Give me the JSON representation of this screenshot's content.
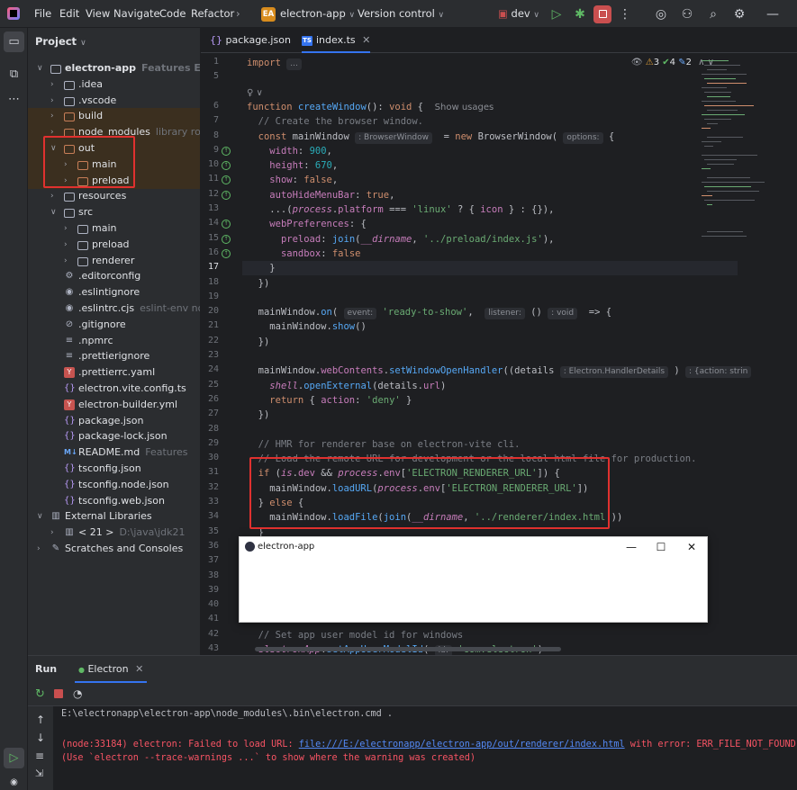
{
  "titlebar": {
    "menus": [
      "File",
      "Edit",
      "View",
      "Navigate",
      "Code",
      "Refactor"
    ],
    "project_badge": "EA",
    "project_name": "electron-app",
    "vcs": "Version control",
    "run_config": "dev"
  },
  "project": {
    "title": "Project",
    "tree": [
      {
        "label": "electron-app",
        "hint": "Features  E:\\electronapp",
        "indent": 0,
        "arrow": "open",
        "icon": "module",
        "excluded": false,
        "bold": true
      },
      {
        "label": ".idea",
        "hint": "",
        "indent": 1,
        "arrow": "closed",
        "icon": "folder",
        "excluded": false
      },
      {
        "label": ".vscode",
        "hint": "",
        "indent": 1,
        "arrow": "closed",
        "icon": "folder",
        "excluded": false
      },
      {
        "label": "build",
        "hint": "",
        "indent": 1,
        "arrow": "closed",
        "icon": "folder",
        "excluded": true
      },
      {
        "label": "node_modules",
        "hint": "library root",
        "indent": 1,
        "arrow": "closed",
        "icon": "folder",
        "excluded": true
      },
      {
        "label": "out",
        "hint": "",
        "indent": 1,
        "arrow": "open",
        "icon": "folder",
        "excluded": true
      },
      {
        "label": "main",
        "hint": "",
        "indent": 2,
        "arrow": "closed",
        "icon": "folder",
        "excluded": true
      },
      {
        "label": "preload",
        "hint": "",
        "indent": 2,
        "arrow": "closed",
        "icon": "folder",
        "excluded": true
      },
      {
        "label": "resources",
        "hint": "",
        "indent": 1,
        "arrow": "closed",
        "icon": "folder",
        "excluded": false
      },
      {
        "label": "src",
        "hint": "",
        "indent": 1,
        "arrow": "open",
        "icon": "folder",
        "excluded": false
      },
      {
        "label": "main",
        "hint": "",
        "indent": 2,
        "arrow": "closed",
        "icon": "folder",
        "excluded": false
      },
      {
        "label": "preload",
        "hint": "",
        "indent": 2,
        "arrow": "closed",
        "icon": "folder",
        "excluded": false
      },
      {
        "label": "renderer",
        "hint": "",
        "indent": 2,
        "arrow": "closed",
        "icon": "folder",
        "excluded": false
      },
      {
        "label": ".editorconfig",
        "hint": "",
        "indent": 1,
        "arrow": "",
        "icon": "gear",
        "excluded": false
      },
      {
        "label": ".eslintignore",
        "hint": "",
        "indent": 1,
        "arrow": "",
        "icon": "eslint",
        "excluded": false
      },
      {
        "label": ".eslintrc.cjs",
        "hint": "eslint-env node",
        "indent": 1,
        "arrow": "",
        "icon": "eslint",
        "excluded": false
      },
      {
        "label": ".gitignore",
        "hint": "",
        "indent": 1,
        "arrow": "",
        "icon": "ignore",
        "excluded": false
      },
      {
        "label": ".npmrc",
        "hint": "",
        "indent": 1,
        "arrow": "",
        "icon": "text",
        "excluded": false
      },
      {
        "label": ".prettierignore",
        "hint": "",
        "indent": 1,
        "arrow": "",
        "icon": "text",
        "excluded": false
      },
      {
        "label": ".prettierrc.yaml",
        "hint": "",
        "indent": 1,
        "arrow": "",
        "icon": "yaml",
        "excluded": false
      },
      {
        "label": "electron.vite.config.ts",
        "hint": "",
        "indent": 1,
        "arrow": "",
        "icon": "ts",
        "excluded": false
      },
      {
        "label": "electron-builder.yml",
        "hint": "",
        "indent": 1,
        "arrow": "",
        "icon": "yaml",
        "excluded": false
      },
      {
        "label": "package.json",
        "hint": "",
        "indent": 1,
        "arrow": "",
        "icon": "json",
        "excluded": false
      },
      {
        "label": "package-lock.json",
        "hint": "",
        "indent": 1,
        "arrow": "",
        "icon": "json",
        "excluded": false
      },
      {
        "label": "README.md",
        "hint": "Features",
        "indent": 1,
        "arrow": "",
        "icon": "md",
        "excluded": false
      },
      {
        "label": "tsconfig.json",
        "hint": "",
        "indent": 1,
        "arrow": "",
        "icon": "json",
        "excluded": false
      },
      {
        "label": "tsconfig.node.json",
        "hint": "",
        "indent": 1,
        "arrow": "",
        "icon": "json",
        "excluded": false
      },
      {
        "label": "tsconfig.web.json",
        "hint": "",
        "indent": 1,
        "arrow": "",
        "icon": "json",
        "excluded": false
      },
      {
        "label": "External Libraries",
        "hint": "",
        "indent": 0,
        "arrow": "open",
        "icon": "library",
        "excluded": false
      },
      {
        "label": "< 21 >",
        "hint": "D:\\java\\jdk21",
        "indent": 1,
        "arrow": "closed",
        "icon": "library",
        "excluded": false
      },
      {
        "label": "Scratches and Consoles",
        "hint": "",
        "indent": 0,
        "arrow": "closed",
        "icon": "scratch",
        "excluded": false
      }
    ]
  },
  "tabs": [
    {
      "label": "package.json",
      "active": false
    },
    {
      "label": "index.ts",
      "active": true
    }
  ],
  "inspections": {
    "warnings": "3",
    "weak_warnings": "4",
    "typos": "2"
  },
  "editor": {
    "lines": [
      {
        "n": "1",
        "html": "<span class='kw'>import</span> <span class='hintbox'>...</span>"
      },
      {
        "n": "5",
        "html": ""
      },
      {
        "n": "",
        "html": "<span class='usages'>♀ ∨</span>"
      },
      {
        "n": "6",
        "html": "<span class='kw'>function</span> <span class='fn'>createWindow</span>(): <span class='kw'>void</span> {  <span class='usages'>Show usages</span>"
      },
      {
        "n": "7",
        "html": "  <span class='cm'>// Create the browser window.</span>"
      },
      {
        "n": "8",
        "html": "  <span class='kw'>const</span> mainWindow <span class='hintbox'>: BrowserWindow</span>  = <span class='kw'>new</span> BrowserWindow( <span class='hintbox'>options:</span> {"
      },
      {
        "n": "9",
        "html": "    <span class='prop'>width</span>: <span class='num'>900</span>,",
        "mark": true
      },
      {
        "n": "10",
        "html": "    <span class='prop'>height</span>: <span class='num'>670</span>,",
        "mark": true
      },
      {
        "n": "11",
        "html": "    <span class='prop'>show</span>: <span class='kw'>false</span>,",
        "mark": true
      },
      {
        "n": "12",
        "html": "    <span class='prop'>autoHideMenuBar</span>: <span class='kw'>true</span>,",
        "mark": true
      },
      {
        "n": "13",
        "html": "    ...(<span class='it'>process</span>.<span class='prop'>platform</span> === <span class='str'>'linux'</span> ? { <span class='prop'>icon</span> } : {}),"
      },
      {
        "n": "14",
        "html": "    <span class='prop'>webPreferences</span>: {",
        "mark": true
      },
      {
        "n": "15",
        "html": "      <span class='prop'>preload</span>: <span class='fn'>join</span>(<span class='it'>__dirname</span>, <span class='str'>'../preload/index.js'</span>),",
        "mark": true
      },
      {
        "n": "16",
        "html": "      <span class='prop'>sandbox</span>: <span class='kw'>false</span>",
        "mark": true
      },
      {
        "n": "17",
        "html": "    }",
        "current": true
      },
      {
        "n": "18",
        "html": "  })"
      },
      {
        "n": "19",
        "html": ""
      },
      {
        "n": "20",
        "html": "  mainWindow.<span class='fn'>on</span>( <span class='hintbox'>event:</span> <span class='str'>'ready-to-show'</span>,  <span class='hintbox'>listener:</span> () <span class='hintbox'>: void</span>  => {"
      },
      {
        "n": "21",
        "html": "    mainWindow.<span class='fn'>show</span>()"
      },
      {
        "n": "22",
        "html": "  })"
      },
      {
        "n": "23",
        "html": ""
      },
      {
        "n": "24",
        "html": "  mainWindow.<span class='prop'>webContents</span>.<span class='fn'>setWindowOpenHandler</span>((details <span class='hintbox'>: Electron.HandlerDetails</span> ) <span class='hintbox'>: {action: strin</span>"
      },
      {
        "n": "25",
        "html": "    <span class='it'>shell</span>.<span class='fn'>openExternal</span>(details.<span class='prop'>url</span>)"
      },
      {
        "n": "26",
        "html": "    <span class='kw'>return</span> { <span class='prop'>action</span>: <span class='str'>'deny'</span> }"
      },
      {
        "n": "27",
        "html": "  })"
      },
      {
        "n": "28",
        "html": ""
      },
      {
        "n": "29",
        "html": "  <span class='cm'>// HMR for renderer base on electron-vite cli.</span>"
      },
      {
        "n": "30",
        "html": "  <span class='cm'>// Load the remote URL for development or the local html file for production.</span>"
      },
      {
        "n": "31",
        "html": "  <span class='kw'>if</span> (<span class='it'>is</span>.<span class='prop'>dev</span> &amp;&amp; <span class='it'>process</span>.<span class='prop'>env</span>[<span class='str'>'ELECTRON_RENDERER_URL'</span>]) {"
      },
      {
        "n": "32",
        "html": "    mainWindow.<span class='fn'>loadURL</span>(<span class='it'>process</span>.<span class='prop'>env</span>[<span class='str'>'ELECTRON_RENDERER_URL'</span>])"
      },
      {
        "n": "33",
        "html": "  } <span class='kw'>else</span> {"
      },
      {
        "n": "34",
        "html": "    mainWindow.<span class='fn'>loadFile</span>(<span class='fn'>join</span>(<span class='it'>__dirname</span>, <span class='str'>'../renderer/index.html'</span>))"
      },
      {
        "n": "35",
        "html": "  }"
      },
      {
        "n": "36",
        "html": ""
      },
      {
        "n": "37",
        "html": ""
      },
      {
        "n": "38",
        "html": ""
      },
      {
        "n": "39",
        "html": ""
      },
      {
        "n": "40",
        "html": ""
      },
      {
        "n": "41",
        "html": ""
      },
      {
        "n": "42",
        "html": "  <span class='cm'>// Set app user model id for windows</span>"
      },
      {
        "n": "43",
        "html": "  <span class='it'>electronApp</span>.<span class='fn'>setAppUserModelId</span>( <span class='hintbox'>id:</span> <span class='str'>'com.electron'</span>)"
      }
    ]
  },
  "popup": {
    "title": "electron-app"
  },
  "run": {
    "title": "Run",
    "tab": "Electron",
    "command": "E:\\electronapp\\electron-app\\node_modules\\.bin\\electron.cmd .",
    "error_prefix": "(node:33184) electron: Failed to load URL: ",
    "error_link": "file:///E:/electronapp/electron-app/out/renderer/index.html",
    "error_suffix": " with error: ERR_FILE_NOT_FOUND",
    "error_line2": "(Use `electron --trace-warnings ...` to show where the warning was created)"
  }
}
